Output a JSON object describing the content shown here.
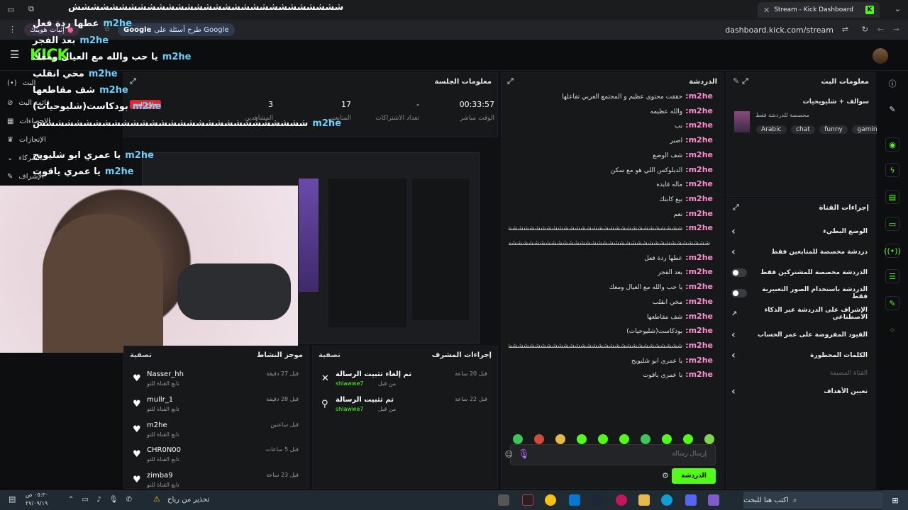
{
  "browser": {
    "tab_title": "Stream - Kick Dashboard",
    "url": "dashboard.kick.com/stream",
    "google_pill": "طرح أسئلة على Google",
    "verify_pill": "إثبات هويتك"
  },
  "header": {
    "logo": "KICK",
    "stream_title_overlay": "الهوسنجار"
  },
  "sidebar": {
    "items": [
      {
        "label": "البث",
        "icon": "broadcast-icon"
      },
      {
        "label": "قائمة البث",
        "icon": "link-icon"
      },
      {
        "label": "الإحصاءات",
        "icon": "chart-icon"
      },
      {
        "label": "الإنجازات",
        "icon": "trophy-icon"
      },
      {
        "label": "الشركاء",
        "icon": "chevron-icon"
      },
      {
        "label": "الإشراف",
        "icon": "wrench-icon"
      }
    ]
  },
  "session": {
    "title": "معلومات الجلسة",
    "live_badge": "خارج البث",
    "stats": [
      {
        "value": "00:33:57",
        "label": "الوقت مباشر"
      },
      {
        "value": "-",
        "label": "تعداد الاشتراكات"
      },
      {
        "value": "17",
        "label": "المتابعين"
      },
      {
        "value": "3",
        "label": "المشاهدين"
      }
    ]
  },
  "overlay_chat": [
    {
      "user": "",
      "msg": "ششششششششششششششششششششششششششششش"
    },
    {
      "user": "m2he",
      "msg": "عطها ردة فعل"
    },
    {
      "user": "m2he",
      "msg": "بعد الفجر"
    },
    {
      "user": "m2he",
      "msg": "يا حب والله مع العيال ومعك"
    },
    {
      "user": "m2he",
      "msg": "مخي انقلب"
    },
    {
      "user": "m2he",
      "msg": "شف مقاطعها"
    },
    {
      "user": "m2he",
      "msg": "بودكاست(شليوحيات)"
    },
    {
      "user": "m2he",
      "msg": "ششششششششششششششششششششششششششششش"
    },
    {
      "user": "m2he",
      "msg": "يا عمري ابو شليويح"
    },
    {
      "user": "m2he",
      "msg": "يا عمري ياقوت"
    }
  ],
  "chat": {
    "title": "الدردشة",
    "messages": [
      {
        "user": "m2he",
        "msg": "حققت محتوى عظيم و المجتمع العربي تفاعلها"
      },
      {
        "user": "m2he",
        "msg": "والله عظيمه"
      },
      {
        "user": "m2he",
        "msg": "بب"
      },
      {
        "user": "m2he",
        "msg": "اصبر"
      },
      {
        "user": "m2he",
        "msg": "شف الوضع"
      },
      {
        "user": "m2he",
        "msg": "الديلوكس اللي هو مع سكن"
      },
      {
        "user": "m2he",
        "msg": "ماله فايده"
      },
      {
        "user": "m2he",
        "msg": "بيع كابتك"
      },
      {
        "user": "m2he",
        "msg": "نعم"
      },
      {
        "user": "m2he",
        "msg": "ششششششششششششششششششششششششششششششششششششششششششششششششش"
      },
      {
        "user": "",
        "msg": "ششششششششششششششششششششششششششششششششششششششششششششششششش"
      },
      {
        "user": "m2he",
        "msg": "عطها ردة فعل"
      },
      {
        "user": "m2he",
        "msg": "بعد الفجر"
      },
      {
        "user": "m2he",
        "msg": "يا حب والله مع العيال ومعك"
      },
      {
        "user": "m2he",
        "msg": "مخي انقلب"
      },
      {
        "user": "m2he",
        "msg": "شف مقاطعها"
      },
      {
        "user": "m2he",
        "msg": "بودكاست(شليوحيات)"
      },
      {
        "user": "m2he",
        "msg": "ششششششششششششششششششششششششششششششششششششششششششششششششش"
      },
      {
        "user": "m2he",
        "msg": "يا عمري ابو شليويح"
      },
      {
        "user": "m2he",
        "msg": "يا عمري ياقوت"
      }
    ],
    "input_placeholder": "إرسال رسالة",
    "send_label": "الدردشة"
  },
  "activity": {
    "title": "موجز النشاط",
    "filter": "تصفية",
    "items": [
      {
        "name": "Nasser_hh",
        "sub": "تابع القناة للتو",
        "time": "قبل 27 دقيقة"
      },
      {
        "name": "mullr_1",
        "sub": "تابع القناة للتو",
        "time": "قبل 28 دقيقة"
      },
      {
        "name": "m2he",
        "sub": "تابع القناة للتو",
        "time": "قبل ساعتين"
      },
      {
        "name": "CHR0N00",
        "sub": "تابع القناة للتو",
        "time": "قبل 5 ساعات"
      },
      {
        "name": "zimba9",
        "sub": "تابع القناة للتو",
        "time": "قبل 23 ساعة"
      }
    ]
  },
  "mod_actions": {
    "title": "إجراءات المشرف",
    "filter": "تصفية",
    "items": [
      {
        "action": "تم إلغاء تثبيت الرسالة",
        "by": "shlawwe7",
        "prefix": "من قبل",
        "time": "قبل 20 ساعة"
      },
      {
        "action": "تم تثبيت الرسالة",
        "by": "shlawwe7",
        "prefix": "من قبل",
        "time": "قبل 22 ساعة"
      }
    ]
  },
  "stream_info": {
    "title": "معلومات البث",
    "stream_name": "سوالف + شليويحيات",
    "category": "مخصصة للدردشة فقط",
    "tags": [
      "Arabic",
      "chat",
      "funny",
      "gaming"
    ]
  },
  "channel_actions": {
    "title": "إجراءات القناة",
    "rows": [
      {
        "label": "الوضع البطيء",
        "control": "chevron"
      },
      {
        "label": "دردشة مخصصة للمتابعين فقط",
        "control": "chevron"
      },
      {
        "label": "الدردشة مخصصة للمشتركين فقط",
        "control": "toggle"
      },
      {
        "label": "الدردشة باستخدام الصور التعبيرية فقط",
        "control": "toggle"
      },
      {
        "label": "الإشراف على الدردشة عبر الذكاء الاصطناعي",
        "control": "link"
      },
      {
        "label": "القيود المفروضة على عمر الحساب",
        "control": "chevron"
      },
      {
        "label": "الكلمات المحظورة",
        "control": "chevron"
      },
      {
        "label": "القناة المضيفة",
        "control": "none"
      },
      {
        "label": "تعيين الأهداف",
        "control": "chevron"
      }
    ]
  },
  "taskbar": {
    "search_placeholder": "اكتب هنا للبحث",
    "weather": "تحذير من رياح",
    "time": "٠٥:٣٠ ص",
    "date": "٢٧/٠٩/١٩"
  },
  "colors": {
    "accent": "#53fc18",
    "username": "#ff8fd0",
    "overlay_user": "#6bd0ff"
  }
}
